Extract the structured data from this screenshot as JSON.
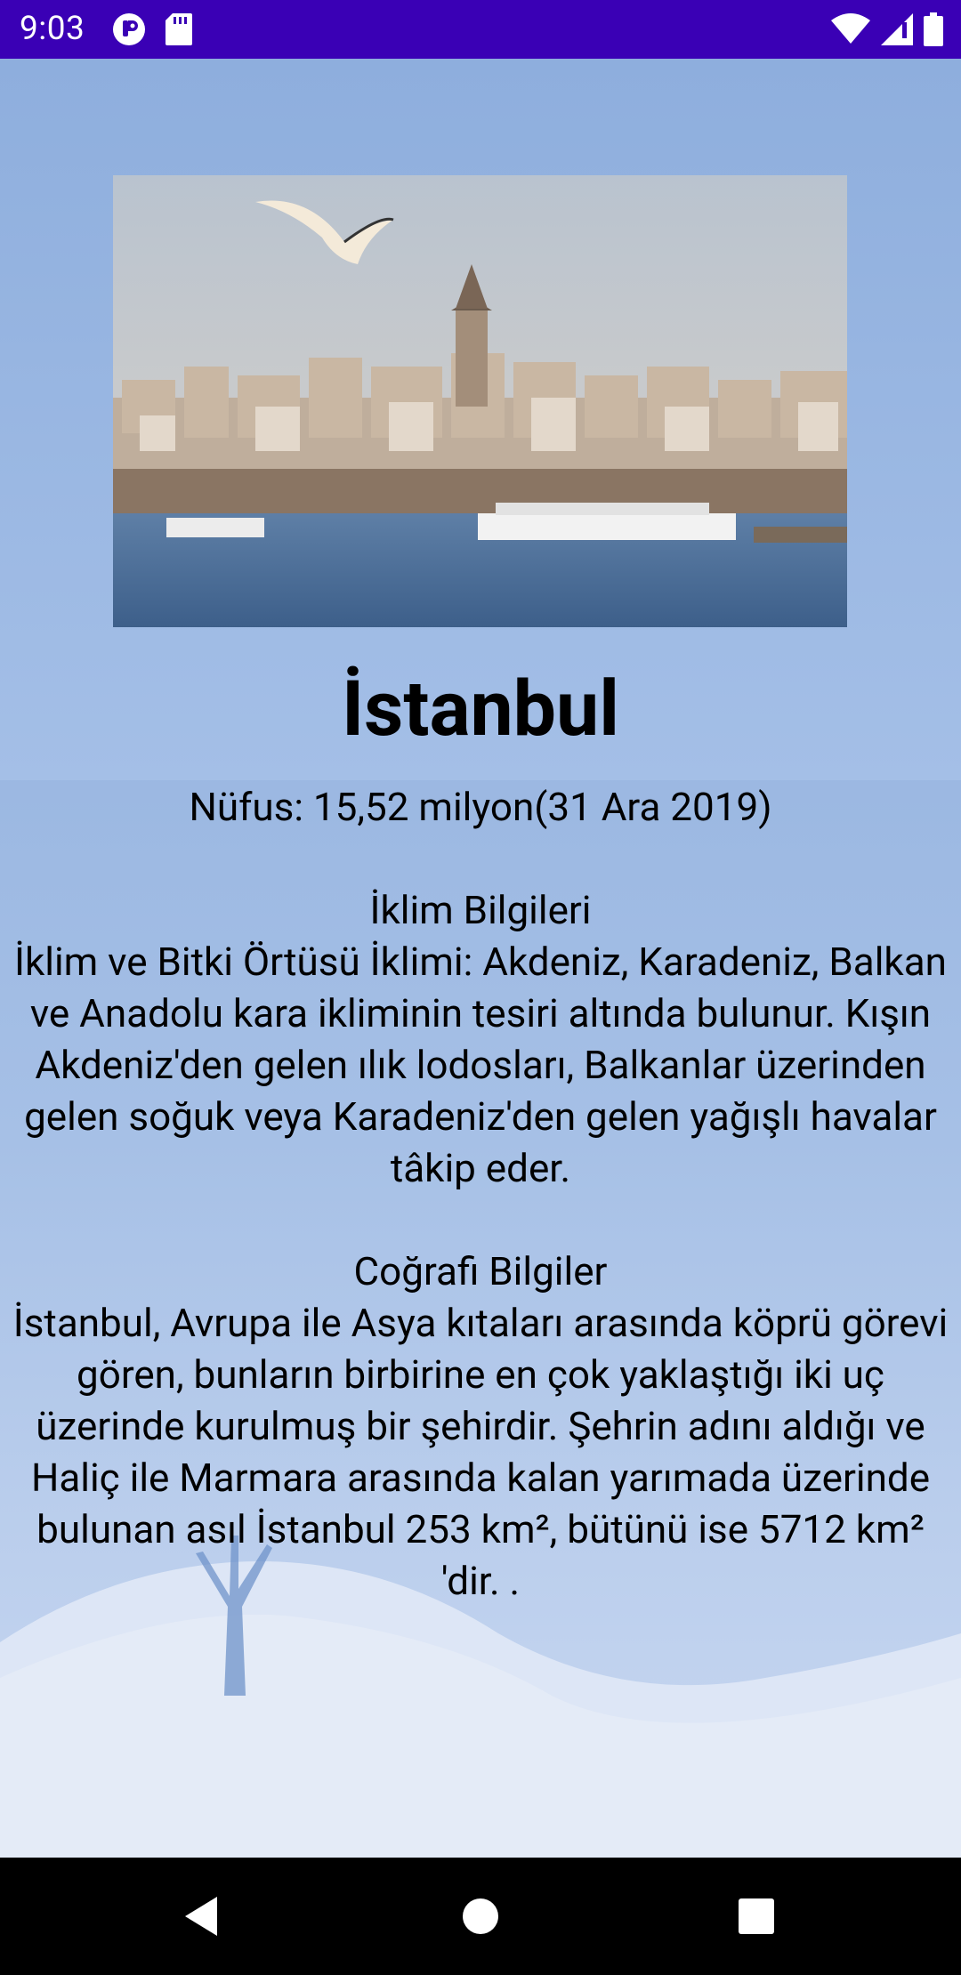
{
  "status_bar": {
    "time": "9:03"
  },
  "city": {
    "title": "İstanbul",
    "photo_alt": "İstanbul"
  },
  "info": {
    "population": "Nüfus: 15,52 milyon(31 Ara 2019)",
    "climate_heading": "İklim Bilgileri",
    "climate_text": "İklim ve Bitki Örtüsü İklimi: Akdeniz, Karadeniz, Balkan ve Anadolu kara ikliminin tesiri altında bulunur. Kışın Akdeniz'den gelen ılık lodosları, Balkanlar üzerinden gelen soğuk veya Karadeniz'den gelen yağışlı havalar tâkip eder.",
    "geo_heading": "Coğrafi Bilgiler",
    "geo_text": "İstanbul, Avrupa ile Asya kıtaları arasında köprü görevi gören, bunların birbirine en çok yaklaştığı iki uç üzerinde kurulmuş bir şehirdir. Şehrin adını aldığı ve Haliç ile Marmara arasında kalan yarımada üzerinde bulunan asıl İstanbul 253 km², bütünü ise 5712 km² 'dir. ."
  },
  "colors": {
    "status_bar": "#3a00b5",
    "background_top": "#8eaedd",
    "background_bottom": "#c9d8f1",
    "nav_bar": "#000000"
  },
  "icons": {
    "status_left": [
      "notification-app-icon",
      "sd-card-icon"
    ],
    "status_right": [
      "wifi-icon",
      "signal-icon",
      "battery-icon"
    ],
    "nav": [
      "back-icon",
      "home-icon",
      "recents-icon"
    ]
  }
}
